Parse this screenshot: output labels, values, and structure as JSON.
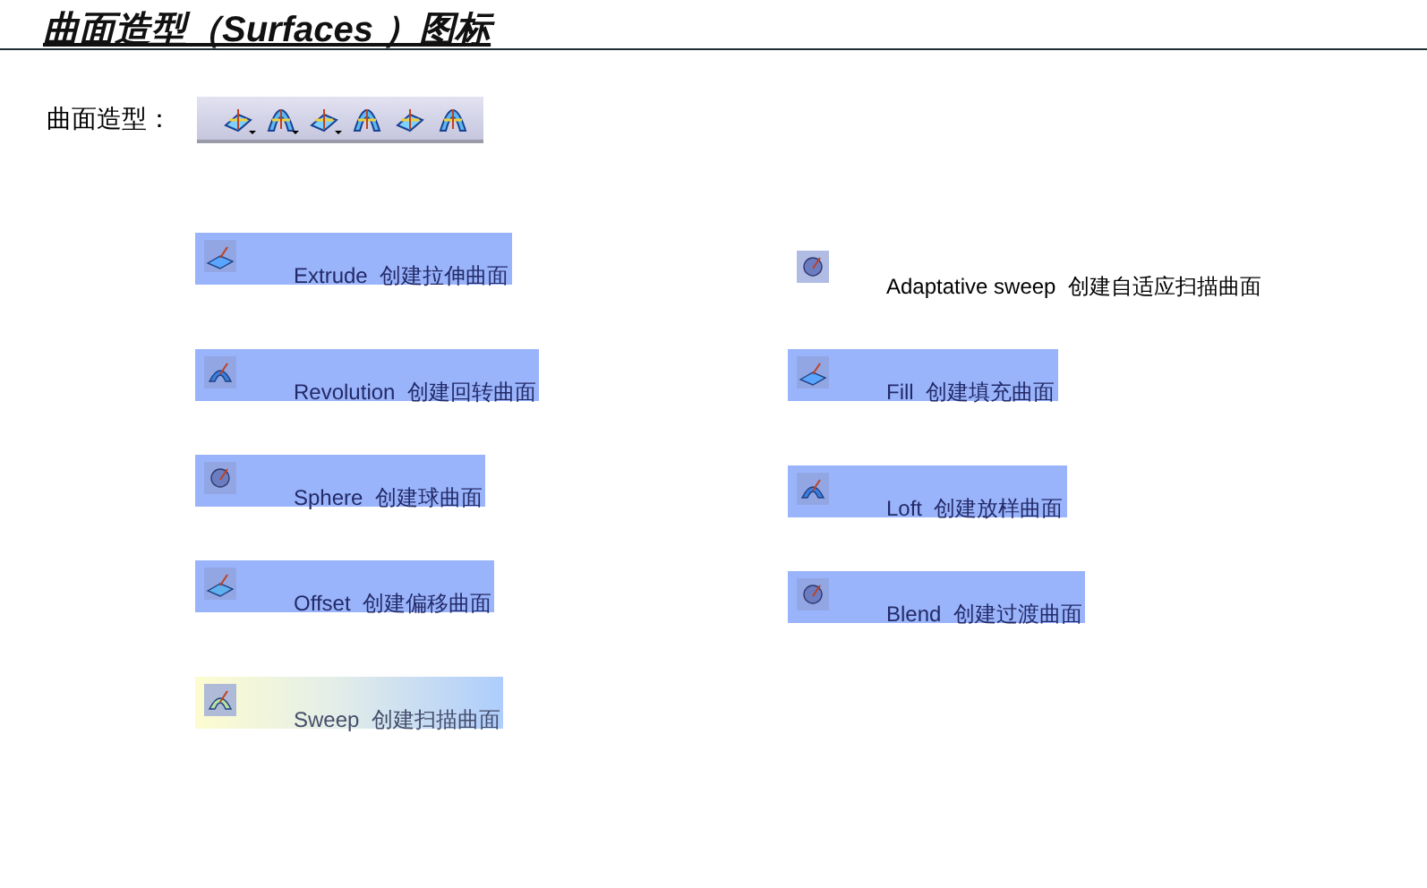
{
  "title": "曲面造型（Surfaces ）图标",
  "toolbar": {
    "label": "曲面造型：",
    "buttons": [
      {
        "dropdown": true
      },
      {
        "dropdown": true
      },
      {
        "dropdown": true
      },
      {
        "dropdown": false
      },
      {
        "dropdown": false
      },
      {
        "dropdown": false
      }
    ]
  },
  "left_items": [
    {
      "kind": "highlight",
      "name": "Extrude",
      "description": "创建拉伸曲面"
    },
    {
      "kind": "highlight",
      "name": "Revolution",
      "description": "创建回转曲面"
    },
    {
      "kind": "highlight",
      "name": "Sphere",
      "description": "创建球曲面"
    },
    {
      "kind": "highlight",
      "name": "Offset",
      "description": "创建偏移曲面"
    },
    {
      "kind": "gradient",
      "name": "Sweep",
      "description": "创建扫描曲面"
    }
  ],
  "right_items": [
    {
      "kind": "plain",
      "name": "Adaptative sweep",
      "description": "创建自适应扫描曲面"
    },
    {
      "kind": "highlight",
      "name": "Fill",
      "description": "创建填充曲面"
    },
    {
      "kind": "highlight",
      "name": "Loft",
      "description": "创建放样曲面"
    },
    {
      "kind": "highlight",
      "name": "Blend",
      "description": "创建过渡曲面"
    }
  ]
}
